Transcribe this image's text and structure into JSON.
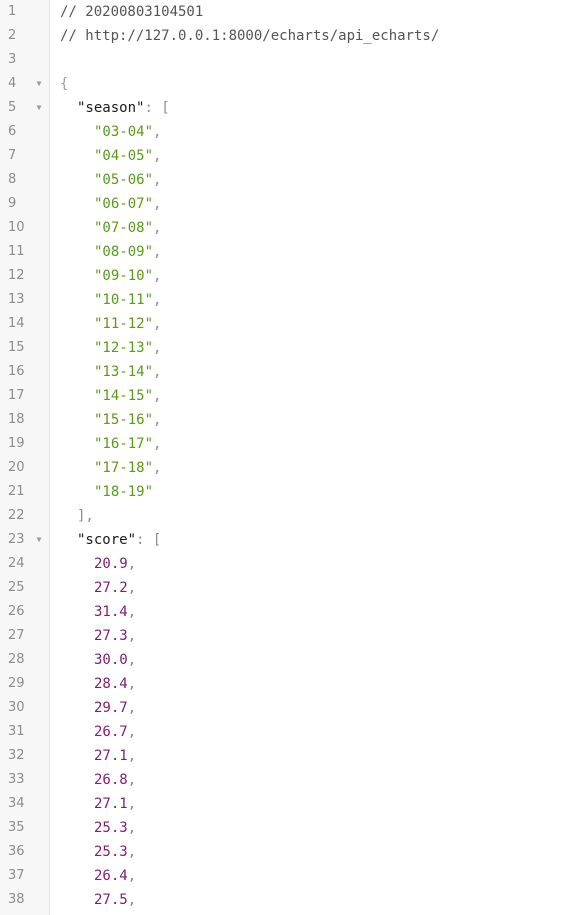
{
  "lines": [
    {
      "n": "1",
      "fold": false,
      "indent": 0,
      "tokens": [
        {
          "t": "comment",
          "v": "// 20200803104501"
        }
      ]
    },
    {
      "n": "2",
      "fold": false,
      "indent": 0,
      "tokens": [
        {
          "t": "comment",
          "v": "// http://127.0.0.1:8000/echarts/api_echarts/"
        }
      ]
    },
    {
      "n": "3",
      "fold": false,
      "indent": 0,
      "tokens": []
    },
    {
      "n": "4",
      "fold": true,
      "indent": 0,
      "tokens": [
        {
          "t": "brace",
          "v": "{"
        }
      ]
    },
    {
      "n": "5",
      "fold": true,
      "indent": 1,
      "tokens": [
        {
          "t": "key",
          "v": "\"season\""
        },
        {
          "t": "punct",
          "v": ": ["
        }
      ]
    },
    {
      "n": "6",
      "fold": false,
      "indent": 2,
      "tokens": [
        {
          "t": "str",
          "v": "\"03-04\""
        },
        {
          "t": "punct",
          "v": ","
        }
      ]
    },
    {
      "n": "7",
      "fold": false,
      "indent": 2,
      "tokens": [
        {
          "t": "str",
          "v": "\"04-05\""
        },
        {
          "t": "punct",
          "v": ","
        }
      ]
    },
    {
      "n": "8",
      "fold": false,
      "indent": 2,
      "tokens": [
        {
          "t": "str",
          "v": "\"05-06\""
        },
        {
          "t": "punct",
          "v": ","
        }
      ]
    },
    {
      "n": "9",
      "fold": false,
      "indent": 2,
      "tokens": [
        {
          "t": "str",
          "v": "\"06-07\""
        },
        {
          "t": "punct",
          "v": ","
        }
      ]
    },
    {
      "n": "10",
      "fold": false,
      "indent": 2,
      "tokens": [
        {
          "t": "str",
          "v": "\"07-08\""
        },
        {
          "t": "punct",
          "v": ","
        }
      ]
    },
    {
      "n": "11",
      "fold": false,
      "indent": 2,
      "tokens": [
        {
          "t": "str",
          "v": "\"08-09\""
        },
        {
          "t": "punct",
          "v": ","
        }
      ]
    },
    {
      "n": "12",
      "fold": false,
      "indent": 2,
      "tokens": [
        {
          "t": "str",
          "v": "\"09-10\""
        },
        {
          "t": "punct",
          "v": ","
        }
      ]
    },
    {
      "n": "13",
      "fold": false,
      "indent": 2,
      "tokens": [
        {
          "t": "str",
          "v": "\"10-11\""
        },
        {
          "t": "punct",
          "v": ","
        }
      ]
    },
    {
      "n": "14",
      "fold": false,
      "indent": 2,
      "tokens": [
        {
          "t": "str",
          "v": "\"11-12\""
        },
        {
          "t": "punct",
          "v": ","
        }
      ]
    },
    {
      "n": "15",
      "fold": false,
      "indent": 2,
      "tokens": [
        {
          "t": "str",
          "v": "\"12-13\""
        },
        {
          "t": "punct",
          "v": ","
        }
      ]
    },
    {
      "n": "16",
      "fold": false,
      "indent": 2,
      "tokens": [
        {
          "t": "str",
          "v": "\"13-14\""
        },
        {
          "t": "punct",
          "v": ","
        }
      ]
    },
    {
      "n": "17",
      "fold": false,
      "indent": 2,
      "tokens": [
        {
          "t": "str",
          "v": "\"14-15\""
        },
        {
          "t": "punct",
          "v": ","
        }
      ]
    },
    {
      "n": "18",
      "fold": false,
      "indent": 2,
      "tokens": [
        {
          "t": "str",
          "v": "\"15-16\""
        },
        {
          "t": "punct",
          "v": ","
        }
      ]
    },
    {
      "n": "19",
      "fold": false,
      "indent": 2,
      "tokens": [
        {
          "t": "str",
          "v": "\"16-17\""
        },
        {
          "t": "punct",
          "v": ","
        }
      ]
    },
    {
      "n": "20",
      "fold": false,
      "indent": 2,
      "tokens": [
        {
          "t": "str",
          "v": "\"17-18\""
        },
        {
          "t": "punct",
          "v": ","
        }
      ]
    },
    {
      "n": "21",
      "fold": false,
      "indent": 2,
      "tokens": [
        {
          "t": "str",
          "v": "\"18-19\""
        }
      ]
    },
    {
      "n": "22",
      "fold": false,
      "indent": 1,
      "tokens": [
        {
          "t": "punct",
          "v": "],"
        }
      ]
    },
    {
      "n": "23",
      "fold": true,
      "indent": 1,
      "tokens": [
        {
          "t": "key",
          "v": "\"score\""
        },
        {
          "t": "punct",
          "v": ": ["
        }
      ]
    },
    {
      "n": "24",
      "fold": false,
      "indent": 2,
      "tokens": [
        {
          "t": "num",
          "v": "20.9"
        },
        {
          "t": "punct",
          "v": ","
        }
      ]
    },
    {
      "n": "25",
      "fold": false,
      "indent": 2,
      "tokens": [
        {
          "t": "num",
          "v": "27.2"
        },
        {
          "t": "punct",
          "v": ","
        }
      ]
    },
    {
      "n": "26",
      "fold": false,
      "indent": 2,
      "tokens": [
        {
          "t": "num",
          "v": "31.4"
        },
        {
          "t": "punct",
          "v": ","
        }
      ]
    },
    {
      "n": "27",
      "fold": false,
      "indent": 2,
      "tokens": [
        {
          "t": "num",
          "v": "27.3"
        },
        {
          "t": "punct",
          "v": ","
        }
      ]
    },
    {
      "n": "28",
      "fold": false,
      "indent": 2,
      "tokens": [
        {
          "t": "num",
          "v": "30.0"
        },
        {
          "t": "punct",
          "v": ","
        }
      ]
    },
    {
      "n": "29",
      "fold": false,
      "indent": 2,
      "tokens": [
        {
          "t": "num",
          "v": "28.4"
        },
        {
          "t": "punct",
          "v": ","
        }
      ]
    },
    {
      "n": "30",
      "fold": false,
      "indent": 2,
      "tokens": [
        {
          "t": "num",
          "v": "29.7"
        },
        {
          "t": "punct",
          "v": ","
        }
      ]
    },
    {
      "n": "31",
      "fold": false,
      "indent": 2,
      "tokens": [
        {
          "t": "num",
          "v": "26.7"
        },
        {
          "t": "punct",
          "v": ","
        }
      ]
    },
    {
      "n": "32",
      "fold": false,
      "indent": 2,
      "tokens": [
        {
          "t": "num",
          "v": "27.1"
        },
        {
          "t": "punct",
          "v": ","
        }
      ]
    },
    {
      "n": "33",
      "fold": false,
      "indent": 2,
      "tokens": [
        {
          "t": "num",
          "v": "26.8"
        },
        {
          "t": "punct",
          "v": ","
        }
      ]
    },
    {
      "n": "34",
      "fold": false,
      "indent": 2,
      "tokens": [
        {
          "t": "num",
          "v": "27.1"
        },
        {
          "t": "punct",
          "v": ","
        }
      ]
    },
    {
      "n": "35",
      "fold": false,
      "indent": 2,
      "tokens": [
        {
          "t": "num",
          "v": "25.3"
        },
        {
          "t": "punct",
          "v": ","
        }
      ]
    },
    {
      "n": "36",
      "fold": false,
      "indent": 2,
      "tokens": [
        {
          "t": "num",
          "v": "25.3"
        },
        {
          "t": "punct",
          "v": ","
        }
      ]
    },
    {
      "n": "37",
      "fold": false,
      "indent": 2,
      "tokens": [
        {
          "t": "num",
          "v": "26.4"
        },
        {
          "t": "punct",
          "v": ","
        }
      ]
    },
    {
      "n": "38",
      "fold": false,
      "indent": 2,
      "tokens": [
        {
          "t": "num",
          "v": "27.5"
        },
        {
          "t": "punct",
          "v": ","
        }
      ]
    }
  ],
  "fold_icon": "fold-triangle-down-icon",
  "colors": {
    "string": "#5a9a1a",
    "number": "#7a1f6b",
    "gutter_bg": "#f7f7f7"
  }
}
